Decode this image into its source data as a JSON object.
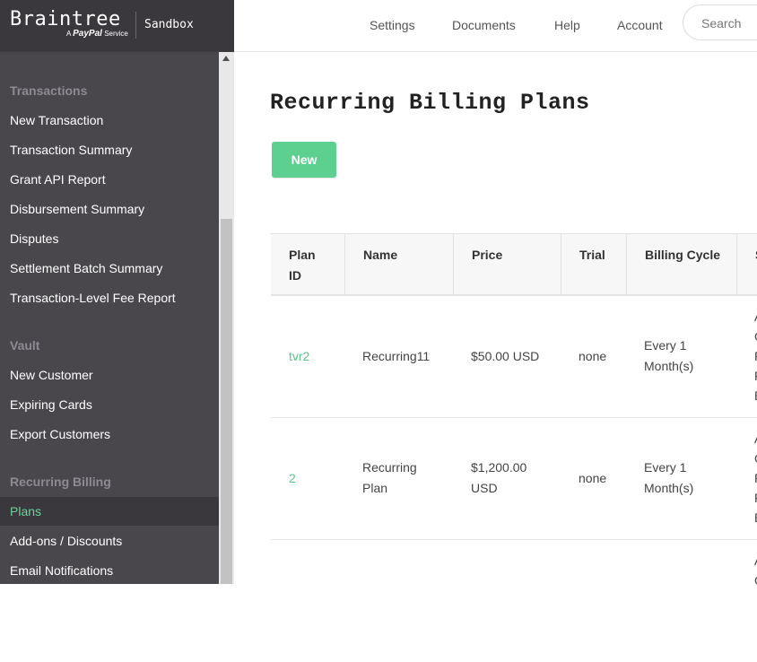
{
  "brand": {
    "name": "Braintree",
    "tagline_prefix": "A",
    "tagline_brand": "PayPal",
    "tagline_suffix": "Service",
    "environment": "Sandbox"
  },
  "topnav": {
    "settings": "Settings",
    "documents": "Documents",
    "help": "Help",
    "account": "Account",
    "search_placeholder": "Search"
  },
  "sidebar": {
    "sections": [
      {
        "title": "Transactions",
        "items": [
          "New Transaction",
          "Transaction Summary",
          "Grant API Report",
          "Disbursement Summary",
          "Disputes",
          "Settlement Batch Summary",
          "Transaction-Level Fee Report"
        ]
      },
      {
        "title": "Vault",
        "items": [
          "New Customer",
          "Expiring Cards",
          "Export Customers"
        ]
      },
      {
        "title": "Recurring Billing",
        "items": [
          "Plans",
          "Add-ons / Discounts",
          "Email Notifications"
        ]
      }
    ],
    "active_item": "Plans"
  },
  "page": {
    "title": "Recurring Billing Plans",
    "new_button": "New"
  },
  "table": {
    "headers": [
      "Plan ID",
      "Name",
      "Price",
      "Trial",
      "Billing Cycle",
      "S"
    ],
    "rows": [
      {
        "plan_id": "tvr2",
        "name": "Recurring11",
        "price": "$50.00 USD",
        "trial": "none",
        "billing_cycle": "Every 1 Month(s)"
      },
      {
        "plan_id": "2",
        "name": "Recurring Plan",
        "price": "$1,200.00 USD",
        "trial": "none",
        "billing_cycle": "Every 1 Month(s)"
      }
    ],
    "truncated_chars": {
      "row1": [
        "A",
        "C",
        "F",
        "F",
        "E"
      ],
      "row2": [
        "A",
        "C",
        "F",
        "F",
        "E"
      ],
      "row3": [
        "A",
        "C"
      ]
    }
  },
  "colors": {
    "accent": "#5dd090",
    "link": "#5cc48c",
    "sidebar_bg": "#49474c"
  }
}
